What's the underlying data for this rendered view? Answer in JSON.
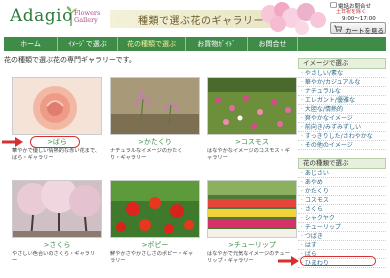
{
  "header": {
    "logo_word": "Adagio",
    "logo_sub_1": "Flowers",
    "logo_sub_2": "Gallery",
    "tagline": "種類で選ぶ花のギャラリー",
    "phone_label": "電話お問合せ",
    "phone_hours_1": "土日祝を除く",
    "phone_hours_2": "9:00～17:00",
    "cart_label": "カートを見る"
  },
  "nav": {
    "items": [
      "ホーム",
      "ｲﾒｰｼﾞで選ぶ",
      "花の種類で選ぶ",
      "お買物ｶﾞｲﾄﾞ",
      "お問合せ"
    ]
  },
  "intro": "花の種類で選ぶ花の専門ギャラリーです。",
  "cards": [
    {
      "label": ">ばら",
      "desc_1": "華やかで優しい情熱的な赤い花まで、",
      "desc_2": "ばら・ギャラリー"
    },
    {
      "label": ">かたくり",
      "desc_1": "ナチュラルなイメージのかたく",
      "desc_2": "り・ギャラリー"
    },
    {
      "label": ">コスモス",
      "desc_1": "はなやかなイメージのコスモス・ギ",
      "desc_2": "ャラリー"
    },
    {
      "label": ">さくら",
      "desc_1": "やさしい色合いのさくら・ギャラリ",
      "desc_2": "ー"
    },
    {
      "label": ">ポピー",
      "desc_1": "鮮やかさやかさしさのポピー・ギャ",
      "desc_2": "ラリー"
    },
    {
      "label": ">チューリップ",
      "desc_1": "はなやかで元気なイメージのチュー",
      "desc_2": "リップ・ギャラリー"
    }
  ],
  "sidebar": {
    "image_head": "イメージで選ぶ",
    "image_items": [
      "やさしい/素な",
      "華やか/カジュアルな",
      "ナチュラルな",
      "エレガント/優雅な",
      "大胆な/情熱的",
      "爽やかなイメージ",
      "前向き/みずみずしい",
      "すっきりした/さわやかな",
      "その他のイメージ"
    ],
    "type_head": "花の種類で選ぶ",
    "type_items": [
      "あじさい",
      "あやめ",
      "かたくり",
      "コスモス",
      "さくら",
      "シャクヤク",
      "チューリップ",
      "つばき",
      "はす",
      "ばら",
      "ひまわり"
    ]
  },
  "colors": {
    "nav_green": "#3f8c49",
    "highlight_red": "#d63030",
    "link_green": "#3f8c49"
  }
}
